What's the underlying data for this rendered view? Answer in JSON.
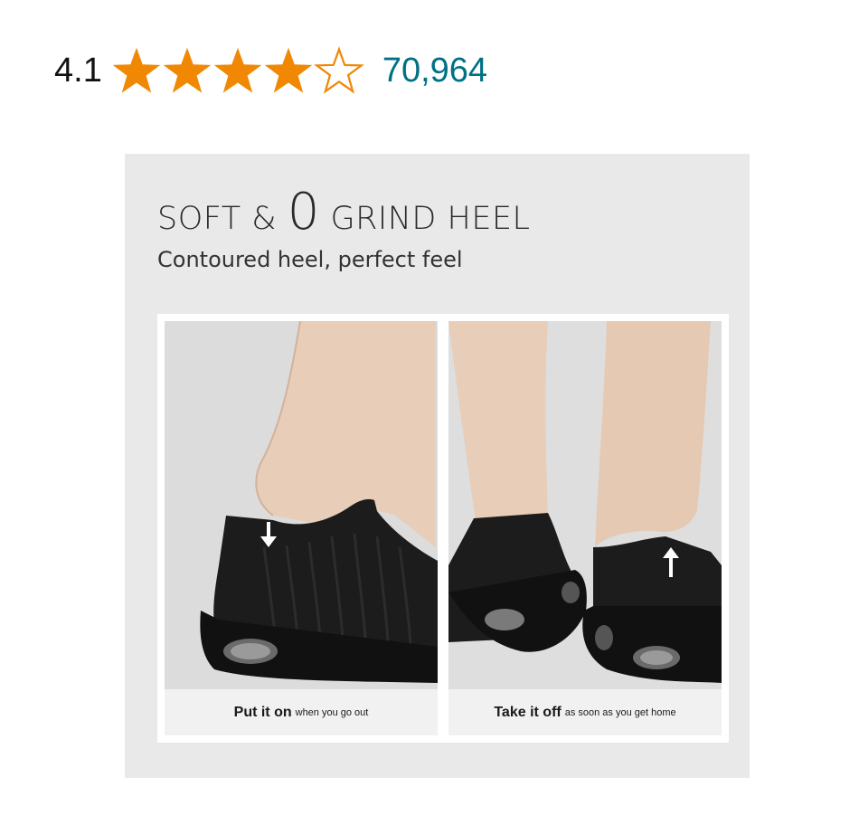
{
  "rating": {
    "value": "4.1",
    "stars_filled": 4,
    "stars_total": 5,
    "star_color": "#f08804",
    "review_count": "70,964",
    "link_color": "#007185"
  },
  "promo": {
    "title_part1": "SOFT & ",
    "title_zero": "0",
    "title_part2": " GRIND HEEL",
    "subtitle": "Contoured heel, perfect feel",
    "panels": [
      {
        "caption_bold": "Put it on",
        "caption_rest": "when you go out",
        "arrow": "down"
      },
      {
        "caption_bold": "Take it off",
        "caption_rest": "as soon as you get home",
        "arrow": "up"
      }
    ]
  }
}
